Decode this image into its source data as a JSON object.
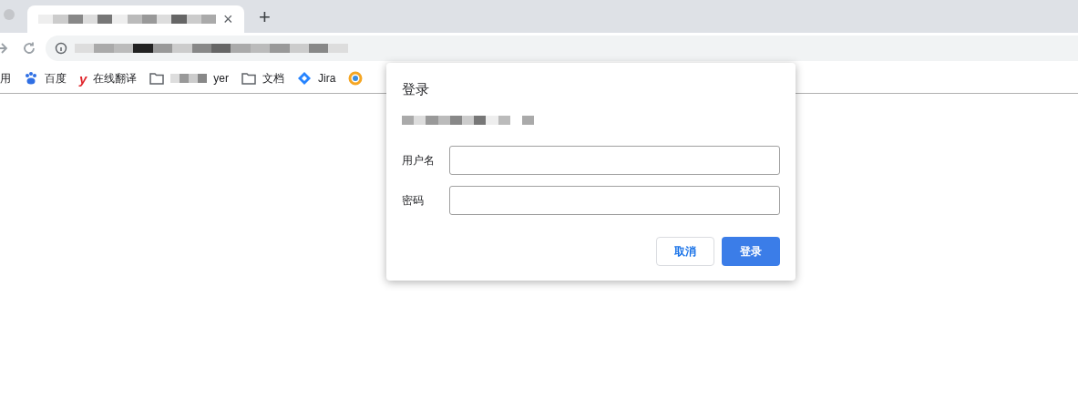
{
  "tab": {
    "close": "×",
    "new_tab": "+"
  },
  "bookmarks": [
    {
      "kind": "plain",
      "label": "用"
    },
    {
      "kind": "paw",
      "label": "百度"
    },
    {
      "kind": "letter",
      "icon": "y",
      "label": "在线翻译"
    },
    {
      "kind": "folder-masked",
      "label": "yer"
    },
    {
      "kind": "folder",
      "label": "文档"
    },
    {
      "kind": "diamond",
      "label": "Jira"
    },
    {
      "kind": "ring"
    }
  ],
  "dialog": {
    "title": "登录",
    "fields": [
      {
        "label": "用户名"
      },
      {
        "label": "密码"
      }
    ],
    "buttons": [
      {
        "kind": "secondary",
        "label": "取消"
      },
      {
        "kind": "primary",
        "label": "登录"
      }
    ]
  }
}
